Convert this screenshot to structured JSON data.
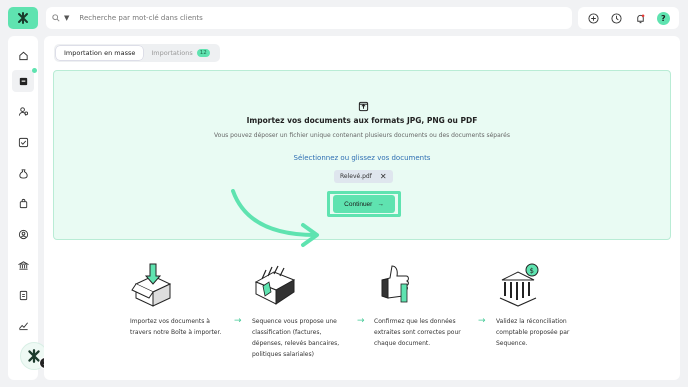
{
  "search": {
    "placeholder": "Recherche par mot-clé dans clients"
  },
  "topbar_icons": [
    "add-circle-icon",
    "history-icon",
    "bell-icon",
    "help-icon"
  ],
  "help_label": "?",
  "sidebar": {
    "items": [
      {
        "icon": "home-icon"
      },
      {
        "icon": "inbox-icon"
      },
      {
        "icon": "users-icon"
      },
      {
        "icon": "checkbox-icon"
      },
      {
        "icon": "money-bag-icon"
      },
      {
        "icon": "shopping-bag-icon"
      },
      {
        "icon": "support-icon"
      },
      {
        "icon": "bank-icon"
      },
      {
        "icon": "document-icon"
      },
      {
        "icon": "chart-line-icon"
      }
    ]
  },
  "assistant": {
    "badge": "3"
  },
  "tabs": [
    {
      "label": "Importation en masse"
    },
    {
      "label": "Importations",
      "count": "12"
    }
  ],
  "dropzone": {
    "title": "Importez vos documents aux formats JPG, PNG ou PDF",
    "subtitle": "Vous pouvez déposer un fichier unique contenant plusieurs documents ou des documents séparés",
    "select_link": "Sélectionnez ou glissez vos documents",
    "file_name": "Relevé.pdf",
    "remove_glyph": "✕",
    "continue_label": "Continuer",
    "continue_arrow": "→"
  },
  "colors": {
    "accent": "#5fe3b0",
    "link": "#2f6fb3",
    "dropzone_bg": "#e9fbf3"
  },
  "steps": [
    {
      "text": "Importez vos documents à travers notre Boîte à importer."
    },
    {
      "text": "Sequence vous propose une classification (factures, dépenses, relevés bancaires, politiques salariales)"
    },
    {
      "text": "Confirmez que les données extraites sont correctes pour chaque document."
    },
    {
      "text": "Validez la réconciliation comptable proposée par Sequence."
    }
  ],
  "step_arrow": "→"
}
